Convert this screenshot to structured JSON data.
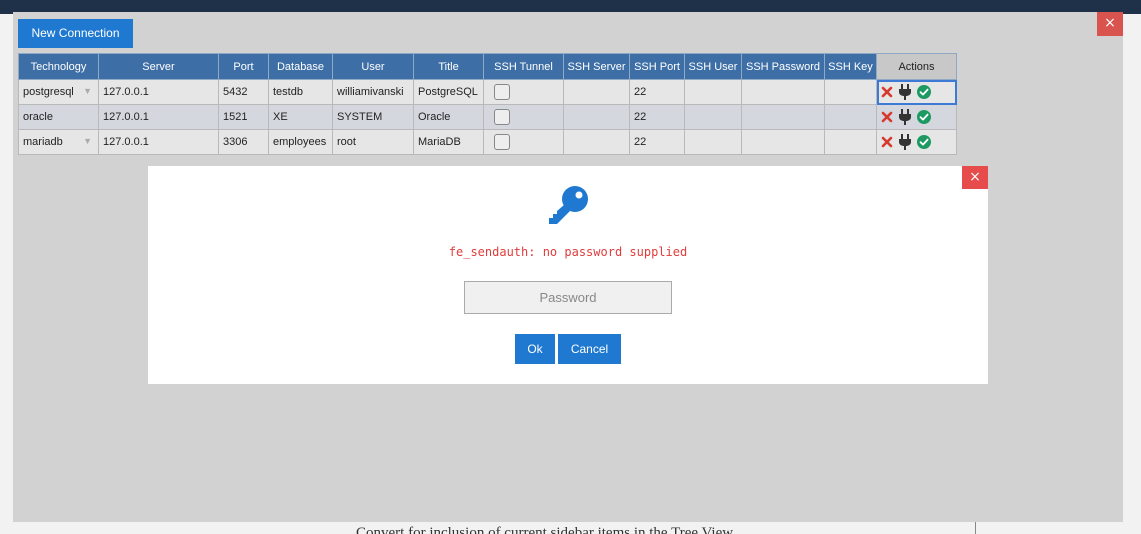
{
  "background": {
    "text": "Convert for inclusion of current sidebar items in the Tree View"
  },
  "window": {
    "close_glyph": "×",
    "new_connection_label": "New Connection"
  },
  "table": {
    "columns": [
      "Technology",
      "Server",
      "Port",
      "Database",
      "User",
      "Title",
      "SSH Tunnel",
      "SSH Server",
      "SSH Port",
      "SSH User",
      "SSH Password",
      "SSH Key",
      "Actions"
    ],
    "rows": [
      {
        "technology": "postgresql",
        "server": "127.0.0.1",
        "port": "5432",
        "database": "testdb",
        "user": "williamivanski",
        "title": "PostgreSQL",
        "ssh_tunnel": false,
        "ssh_server": "",
        "ssh_port": "22",
        "ssh_user": "",
        "ssh_password": "",
        "ssh_key": ""
      },
      {
        "technology": "oracle",
        "server": "127.0.0.1",
        "port": "1521",
        "database": "XE",
        "user": "SYSTEM",
        "title": "Oracle",
        "ssh_tunnel": false,
        "ssh_server": "",
        "ssh_port": "22",
        "ssh_user": "",
        "ssh_password": "",
        "ssh_key": ""
      },
      {
        "technology": "mariadb",
        "server": "127.0.0.1",
        "port": "3306",
        "database": "employees",
        "user": "root",
        "title": "MariaDB",
        "ssh_tunnel": false,
        "ssh_server": "",
        "ssh_port": "22",
        "ssh_user": "",
        "ssh_password": "",
        "ssh_key": ""
      }
    ],
    "action_icons": [
      "delete-icon",
      "plug-icon",
      "check-circle-icon"
    ]
  },
  "modal": {
    "close_glyph": "×",
    "icon": "key-icon",
    "error_message": "fe_sendauth: no password supplied",
    "password_placeholder": "Password",
    "password_value": "",
    "ok_label": "Ok",
    "cancel_label": "Cancel"
  },
  "colors": {
    "primary_button": "#1f79d0",
    "header_bg": "#3d6ea6",
    "error_text": "#e03c3c",
    "close_red": "#e74c4c",
    "key_blue": "#1f79d0"
  }
}
